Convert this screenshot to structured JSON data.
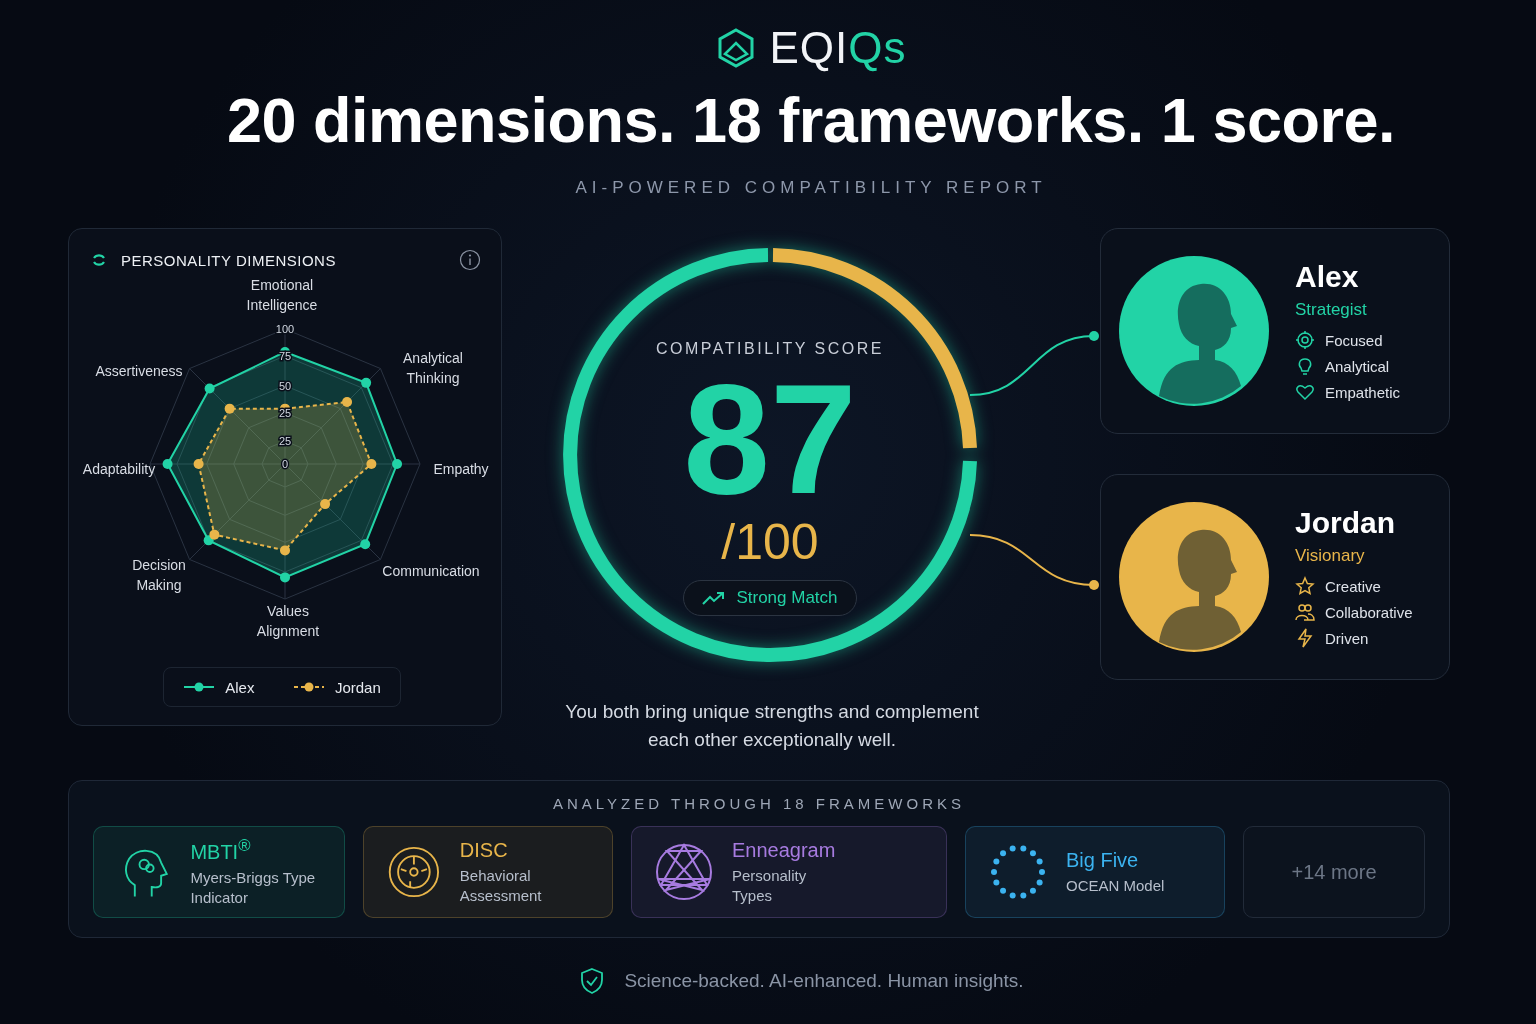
{
  "brand": {
    "logo_main": "EQI",
    "logo_accent": "Qs"
  },
  "headline": "20 dimensions. 18 frameworks. 1 score.",
  "subtitle": "AI-POWERED COMPATIBILITY REPORT",
  "radar_panel": {
    "title": "PERSONALITY DIMENSIONS",
    "axis_labels": [
      "Emotional Intelligence",
      "Assertiveness",
      "Analytical Thinking",
      "Adaptability",
      "Empathy",
      "Decision Making",
      "Communication",
      "Values Alignment"
    ],
    "ring_labels": [
      "100",
      "75",
      "50",
      "25",
      "25",
      "0"
    ],
    "legend": [
      {
        "name": "Alex",
        "color": "#22d3a6",
        "dashed": false
      },
      {
        "name": "Jordan",
        "color": "#e8b54a",
        "dashed": true
      }
    ]
  },
  "score": {
    "label": "COMPATIBILITY SCORE",
    "value": "87",
    "out_of": "/100",
    "badge": "Strong Match",
    "summary": "You both bring unique strengths and complement each other exceptionally well."
  },
  "profiles": [
    {
      "name": "Alex",
      "role": "Strategist",
      "color": "#22d3a6",
      "traits": [
        {
          "kind": "target",
          "label": "Focused"
        },
        {
          "kind": "bulb",
          "label": "Analytical"
        },
        {
          "kind": "heart",
          "label": "Empathetic"
        }
      ]
    },
    {
      "name": "Jordan",
      "role": "Visionary",
      "color": "#e8b54a",
      "traits": [
        {
          "kind": "star",
          "label": "Creative"
        },
        {
          "kind": "people",
          "label": "Collaborative"
        },
        {
          "kind": "bolt",
          "label": "Driven"
        }
      ]
    }
  ],
  "frameworks": {
    "title": "ANALYZED THROUGH 18 FRAMEWORKS",
    "items": [
      {
        "kind": "head",
        "name": "MBTI$^{®}$",
        "description": "Myers-Briggs Type Indicator",
        "color": "#22d3a6"
      },
      {
        "kind": "dial",
        "name": "DISC",
        "description": "Behavioral Assessment",
        "color": "#e8b54a"
      },
      {
        "kind": "enneagram",
        "name": "Enneagram",
        "description": "Personality Types",
        "color": "#a77be0"
      },
      {
        "kind": "dots",
        "name": "Big Five",
        "description": "OCEAN Model",
        "color": "#3bb3f0"
      }
    ],
    "more": "+14 more"
  },
  "footer": {
    "text": "Science-backed. AI-enhanced. Human insights."
  }
}
